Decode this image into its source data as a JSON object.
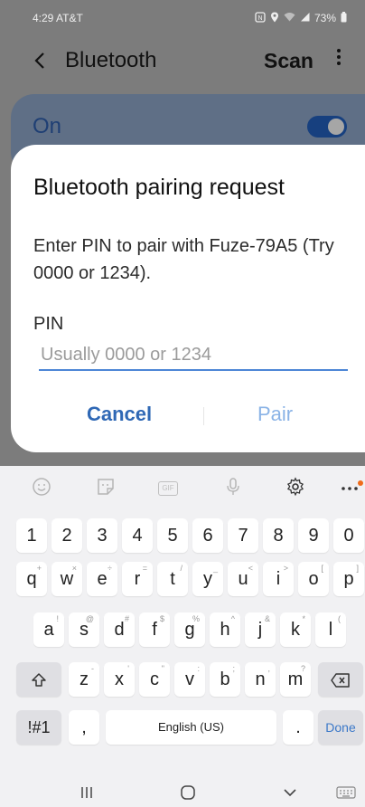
{
  "status_bar": {
    "time": "4:29",
    "carrier": "AT&T",
    "battery": "73%"
  },
  "app_bar": {
    "title": "Bluetooth",
    "scan_label": "Scan"
  },
  "bluetooth_toggle": {
    "label": "On",
    "state": true
  },
  "dialog": {
    "title": "Bluetooth pairing request",
    "message": "Enter PIN to pair with Fuze-79A5 (Try 0000 or 1234).",
    "pin_label": "PIN",
    "pin_placeholder": "Usually 0000 or 1234",
    "pin_value": "",
    "cancel_label": "Cancel",
    "pair_label": "Pair"
  },
  "keyboard": {
    "number_row": [
      "1",
      "2",
      "3",
      "4",
      "5",
      "6",
      "7",
      "8",
      "9",
      "0"
    ],
    "row1": [
      {
        "k": "q",
        "s": "+"
      },
      {
        "k": "w",
        "s": "×"
      },
      {
        "k": "e",
        "s": "÷"
      },
      {
        "k": "r",
        "s": "="
      },
      {
        "k": "t",
        "s": "/"
      },
      {
        "k": "y",
        "s": "_"
      },
      {
        "k": "u",
        "s": "<"
      },
      {
        "k": "i",
        "s": ">"
      },
      {
        "k": "o",
        "s": "["
      },
      {
        "k": "p",
        "s": "]"
      }
    ],
    "row2": [
      {
        "k": "a",
        "s": "!"
      },
      {
        "k": "s",
        "s": "@"
      },
      {
        "k": "d",
        "s": "#"
      },
      {
        "k": "f",
        "s": "$"
      },
      {
        "k": "g",
        "s": "%"
      },
      {
        "k": "h",
        "s": "^"
      },
      {
        "k": "j",
        "s": "&"
      },
      {
        "k": "k",
        "s": "*"
      },
      {
        "k": "l",
        "s": "("
      }
    ],
    "row3": [
      {
        "k": "z",
        "s": "-"
      },
      {
        "k": "x",
        "s": "'"
      },
      {
        "k": "c",
        "s": "\""
      },
      {
        "k": "v",
        "s": ":"
      },
      {
        "k": "b",
        "s": ";"
      },
      {
        "k": "n",
        "s": ","
      },
      {
        "k": "m",
        "s": "?"
      }
    ],
    "symbols_label": "!#1",
    "comma": ",",
    "space_label": "English (US)",
    "period": ".",
    "done_label": "Done"
  },
  "icons": {
    "back": "chevron-left-icon",
    "more": "more-vert-icon",
    "emoji": "emoji-icon",
    "sticker": "sticker-icon",
    "gif": "gif-icon",
    "mic": "mic-icon",
    "settings": "gear-icon",
    "toolbar_more": "more-horiz-icon",
    "shift": "shift-icon",
    "backspace": "backspace-icon",
    "nav_recents": "recents-icon",
    "nav_home": "home-icon",
    "nav_back": "back-nav-icon",
    "nav_keyboard": "keyboard-icon"
  },
  "colors": {
    "accent": "#2f68b5",
    "input_underline": "#4d86d6",
    "notification_dot": "#ef6c1b"
  }
}
